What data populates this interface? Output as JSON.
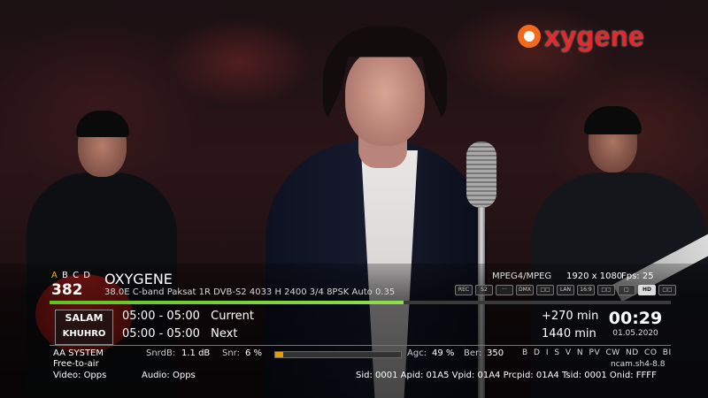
{
  "logo": {
    "text": "xygene",
    "colors": {
      "o_ring": "#f26a1b",
      "text": "#e8272b"
    }
  },
  "channel": {
    "groups": {
      "active": "A",
      "others": "B C D"
    },
    "number": "382",
    "name": "OXYGENE",
    "sat_info": "38.0E C-band Paksat 1R DVB-S2 4033 H 2400 3/4 8PSK  Auto 0.35",
    "codec": "MPEG4/MPEG",
    "resolution": "1920 x 1080",
    "fps_label": "Fps:",
    "fps_value": "25",
    "flags": [
      "REC",
      "S2",
      "···",
      "DMX",
      "□□",
      "LAN",
      "16:9",
      "□□",
      "□",
      "HD",
      "□□"
    ],
    "progress_fraction": 0.57
  },
  "provider": {
    "line1": "SALAM",
    "line2": "KHUHRO"
  },
  "epg": [
    {
      "time": "05:00  - 05:00",
      "title": "Current",
      "duration": "+270 min"
    },
    {
      "time": "05:00  - 05:00",
      "title": "Next",
      "duration": "1440 min"
    }
  ],
  "clock": {
    "time": "00:29",
    "date": "01.05.2020"
  },
  "info": {
    "system": "AA SYSTEM",
    "fta": "Free-to-air",
    "video": "Video: Opps",
    "audio": "Audio: Opps",
    "snrdb_label": "SnrdB:",
    "snrdb_value": "1.1 dB",
    "snr_label": "Snr:",
    "snr_value": "6 %",
    "snr_fraction": 0.06,
    "agc_label": "Agc:",
    "agc_value": "49 %",
    "ber_label": "Ber:",
    "ber_value": "350",
    "cas": "B D I S V N PV CW ND CO BI",
    "cam": "ncam.sh4-8.8",
    "pids": "Sid: 0001  Apid: 01A5  Vpid: 01A4  Prcpid: 01A4  Tsid: 0001  Onid: FFFF"
  }
}
